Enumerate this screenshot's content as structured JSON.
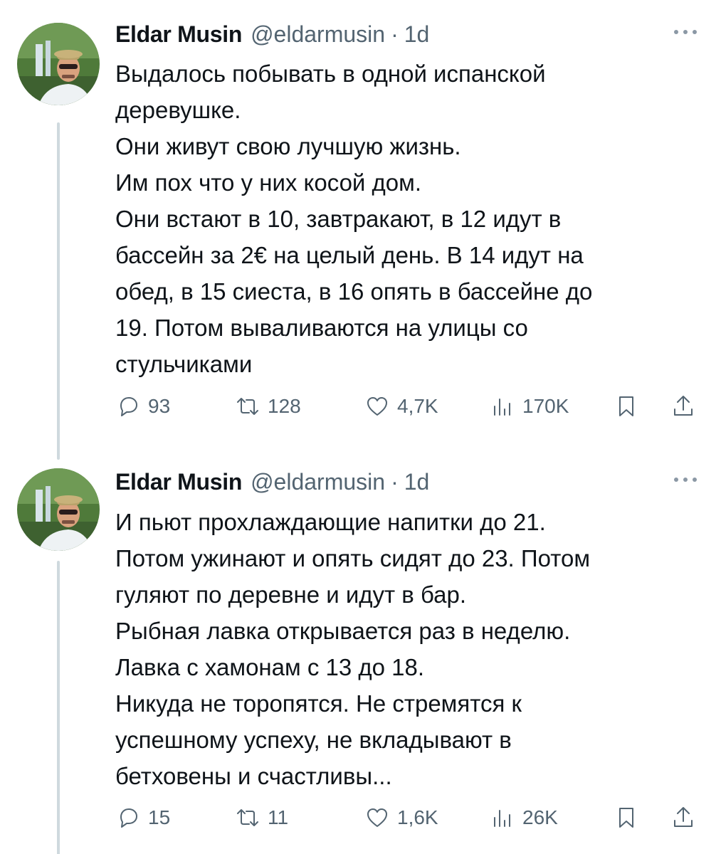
{
  "tweets": [
    {
      "author_name": "Eldar Musin",
      "handle": "@eldarmusin",
      "separator": "·",
      "time": "1d",
      "lines": [
        "Выдалось побывать в одной испанской",
        "деревушке.",
        "Они живут свою лучшую жизнь.",
        "Им пох что у них косой дом.",
        "Они встают в 10, завтракают, в 12 идут в",
        "бассейн за 2€ на целый день. В 14 идут на",
        "обед, в 15 сиеста, в 16 опять в бассейне до",
        "19. Потом вываливаются на улицы со",
        "стульчиками"
      ],
      "replies": "93",
      "retweets": "128",
      "likes": "4,7K",
      "views": "170K"
    },
    {
      "author_name": "Eldar Musin",
      "handle": "@eldarmusin",
      "separator": "·",
      "time": "1d",
      "lines": [
        "И пьют прохлаждающие напитки до 21.",
        "Потом ужинают и опять сидят до 23. Потом",
        "гуляют по деревне и идут в бар.",
        "Рыбная лавка открывается раз в неделю.",
        "Лавка с хамонам с 13 до 18.",
        "Никуда не торопятся. Не стремятся к",
        "успешному успеху, не вкладывают в",
        "бетховены и счастливы..."
      ],
      "replies": "15",
      "retweets": "11",
      "likes": "1,6K",
      "views": "26K"
    }
  ],
  "icons": {
    "reply": "reply-icon",
    "retweet": "retweet-icon",
    "like": "heart-icon",
    "views": "views-icon",
    "bookmark": "bookmark-icon",
    "share": "share-icon",
    "more": "more-icon"
  },
  "colors": {
    "text": "#0f1419",
    "secondary": "#536471",
    "thread_line": "#cfd9de"
  }
}
